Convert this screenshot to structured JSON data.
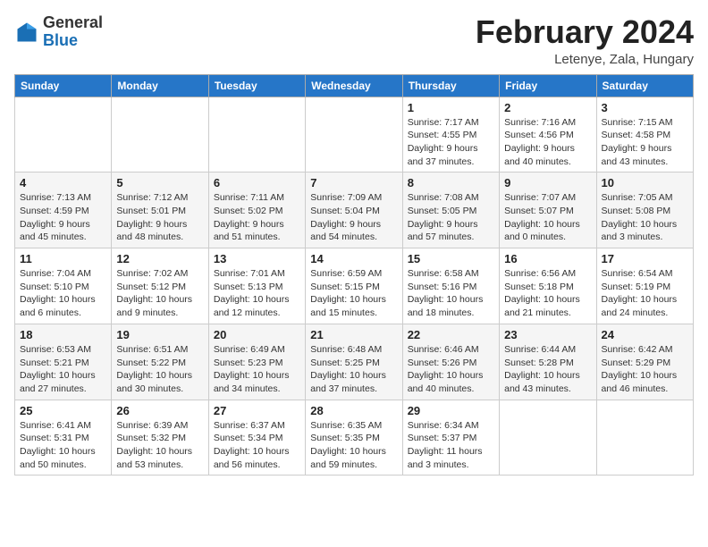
{
  "header": {
    "logo_general": "General",
    "logo_blue": "Blue",
    "title": "February 2024",
    "subtitle": "Letenye, Zala, Hungary"
  },
  "days_of_week": [
    "Sunday",
    "Monday",
    "Tuesday",
    "Wednesday",
    "Thursday",
    "Friday",
    "Saturday"
  ],
  "weeks": [
    [
      {
        "day": "",
        "info": ""
      },
      {
        "day": "",
        "info": ""
      },
      {
        "day": "",
        "info": ""
      },
      {
        "day": "",
        "info": ""
      },
      {
        "day": "1",
        "info": "Sunrise: 7:17 AM\nSunset: 4:55 PM\nDaylight: 9 hours\nand 37 minutes."
      },
      {
        "day": "2",
        "info": "Sunrise: 7:16 AM\nSunset: 4:56 PM\nDaylight: 9 hours\nand 40 minutes."
      },
      {
        "day": "3",
        "info": "Sunrise: 7:15 AM\nSunset: 4:58 PM\nDaylight: 9 hours\nand 43 minutes."
      }
    ],
    [
      {
        "day": "4",
        "info": "Sunrise: 7:13 AM\nSunset: 4:59 PM\nDaylight: 9 hours\nand 45 minutes."
      },
      {
        "day": "5",
        "info": "Sunrise: 7:12 AM\nSunset: 5:01 PM\nDaylight: 9 hours\nand 48 minutes."
      },
      {
        "day": "6",
        "info": "Sunrise: 7:11 AM\nSunset: 5:02 PM\nDaylight: 9 hours\nand 51 minutes."
      },
      {
        "day": "7",
        "info": "Sunrise: 7:09 AM\nSunset: 5:04 PM\nDaylight: 9 hours\nand 54 minutes."
      },
      {
        "day": "8",
        "info": "Sunrise: 7:08 AM\nSunset: 5:05 PM\nDaylight: 9 hours\nand 57 minutes."
      },
      {
        "day": "9",
        "info": "Sunrise: 7:07 AM\nSunset: 5:07 PM\nDaylight: 10 hours\nand 0 minutes."
      },
      {
        "day": "10",
        "info": "Sunrise: 7:05 AM\nSunset: 5:08 PM\nDaylight: 10 hours\nand 3 minutes."
      }
    ],
    [
      {
        "day": "11",
        "info": "Sunrise: 7:04 AM\nSunset: 5:10 PM\nDaylight: 10 hours\nand 6 minutes."
      },
      {
        "day": "12",
        "info": "Sunrise: 7:02 AM\nSunset: 5:12 PM\nDaylight: 10 hours\nand 9 minutes."
      },
      {
        "day": "13",
        "info": "Sunrise: 7:01 AM\nSunset: 5:13 PM\nDaylight: 10 hours\nand 12 minutes."
      },
      {
        "day": "14",
        "info": "Sunrise: 6:59 AM\nSunset: 5:15 PM\nDaylight: 10 hours\nand 15 minutes."
      },
      {
        "day": "15",
        "info": "Sunrise: 6:58 AM\nSunset: 5:16 PM\nDaylight: 10 hours\nand 18 minutes."
      },
      {
        "day": "16",
        "info": "Sunrise: 6:56 AM\nSunset: 5:18 PM\nDaylight: 10 hours\nand 21 minutes."
      },
      {
        "day": "17",
        "info": "Sunrise: 6:54 AM\nSunset: 5:19 PM\nDaylight: 10 hours\nand 24 minutes."
      }
    ],
    [
      {
        "day": "18",
        "info": "Sunrise: 6:53 AM\nSunset: 5:21 PM\nDaylight: 10 hours\nand 27 minutes."
      },
      {
        "day": "19",
        "info": "Sunrise: 6:51 AM\nSunset: 5:22 PM\nDaylight: 10 hours\nand 30 minutes."
      },
      {
        "day": "20",
        "info": "Sunrise: 6:49 AM\nSunset: 5:23 PM\nDaylight: 10 hours\nand 34 minutes."
      },
      {
        "day": "21",
        "info": "Sunrise: 6:48 AM\nSunset: 5:25 PM\nDaylight: 10 hours\nand 37 minutes."
      },
      {
        "day": "22",
        "info": "Sunrise: 6:46 AM\nSunset: 5:26 PM\nDaylight: 10 hours\nand 40 minutes."
      },
      {
        "day": "23",
        "info": "Sunrise: 6:44 AM\nSunset: 5:28 PM\nDaylight: 10 hours\nand 43 minutes."
      },
      {
        "day": "24",
        "info": "Sunrise: 6:42 AM\nSunset: 5:29 PM\nDaylight: 10 hours\nand 46 minutes."
      }
    ],
    [
      {
        "day": "25",
        "info": "Sunrise: 6:41 AM\nSunset: 5:31 PM\nDaylight: 10 hours\nand 50 minutes."
      },
      {
        "day": "26",
        "info": "Sunrise: 6:39 AM\nSunset: 5:32 PM\nDaylight: 10 hours\nand 53 minutes."
      },
      {
        "day": "27",
        "info": "Sunrise: 6:37 AM\nSunset: 5:34 PM\nDaylight: 10 hours\nand 56 minutes."
      },
      {
        "day": "28",
        "info": "Sunrise: 6:35 AM\nSunset: 5:35 PM\nDaylight: 10 hours\nand 59 minutes."
      },
      {
        "day": "29",
        "info": "Sunrise: 6:34 AM\nSunset: 5:37 PM\nDaylight: 11 hours\nand 3 minutes."
      },
      {
        "day": "",
        "info": ""
      },
      {
        "day": "",
        "info": ""
      }
    ]
  ]
}
